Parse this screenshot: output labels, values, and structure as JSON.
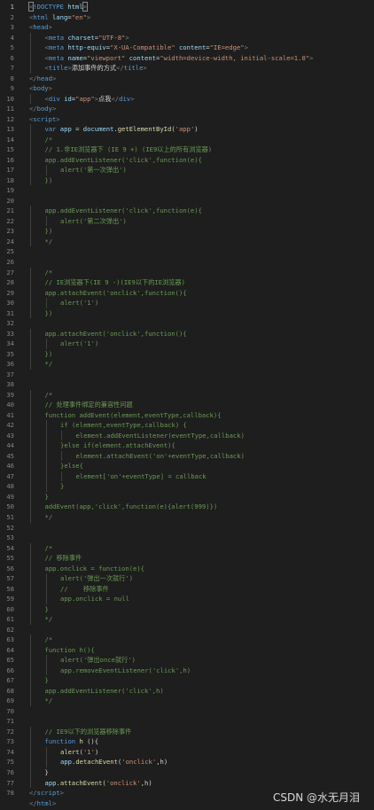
{
  "editor": {
    "lines": [
      {
        "n": "1",
        "indent": 0,
        "segs": [
          {
            "t": "<",
            "c": "c-pun"
          },
          {
            "t": "!DOCTYPE",
            "c": "c-tag"
          },
          {
            "t": " html",
            "c": "c-attr"
          },
          {
            "t": ">",
            "c": "c-pun"
          }
        ]
      },
      {
        "n": "2",
        "indent": 0,
        "segs": [
          {
            "t": "<",
            "c": "c-pun"
          },
          {
            "t": "html",
            "c": "c-tag"
          },
          {
            "t": " lang",
            "c": "c-attr"
          },
          {
            "t": "=",
            "c": "c-txt"
          },
          {
            "t": "\"en\"",
            "c": "c-str"
          },
          {
            "t": ">",
            "c": "c-pun"
          }
        ]
      },
      {
        "n": "3",
        "indent": 0,
        "segs": [
          {
            "t": "<",
            "c": "c-pun"
          },
          {
            "t": "head",
            "c": "c-tag"
          },
          {
            "t": ">",
            "c": "c-pun"
          }
        ]
      },
      {
        "n": "4",
        "indent": 1,
        "segs": [
          {
            "t": "<",
            "c": "c-pun"
          },
          {
            "t": "meta",
            "c": "c-tag"
          },
          {
            "t": " charset",
            "c": "c-attr"
          },
          {
            "t": "=",
            "c": "c-txt"
          },
          {
            "t": "\"UTF-8\"",
            "c": "c-str"
          },
          {
            "t": ">",
            "c": "c-pun"
          }
        ]
      },
      {
        "n": "5",
        "indent": 1,
        "segs": [
          {
            "t": "<",
            "c": "c-pun"
          },
          {
            "t": "meta",
            "c": "c-tag"
          },
          {
            "t": " http-equiv",
            "c": "c-attr"
          },
          {
            "t": "=",
            "c": "c-txt"
          },
          {
            "t": "\"X-UA-Compatible\"",
            "c": "c-str"
          },
          {
            "t": " content",
            "c": "c-attr"
          },
          {
            "t": "=",
            "c": "c-txt"
          },
          {
            "t": "\"IE=edge\"",
            "c": "c-str"
          },
          {
            "t": ">",
            "c": "c-pun"
          }
        ]
      },
      {
        "n": "6",
        "indent": 1,
        "segs": [
          {
            "t": "<",
            "c": "c-pun"
          },
          {
            "t": "meta",
            "c": "c-tag"
          },
          {
            "t": " name",
            "c": "c-attr"
          },
          {
            "t": "=",
            "c": "c-txt"
          },
          {
            "t": "\"viewport\"",
            "c": "c-str"
          },
          {
            "t": " content",
            "c": "c-attr"
          },
          {
            "t": "=",
            "c": "c-txt"
          },
          {
            "t": "\"width=device-width, initial-scale=1.0\"",
            "c": "c-str"
          },
          {
            "t": ">",
            "c": "c-pun"
          }
        ]
      },
      {
        "n": "7",
        "indent": 1,
        "segs": [
          {
            "t": "<",
            "c": "c-pun"
          },
          {
            "t": "title",
            "c": "c-tag"
          },
          {
            "t": ">",
            "c": "c-pun"
          },
          {
            "t": "添加事件的方式",
            "c": "c-txt"
          },
          {
            "t": "</",
            "c": "c-pun"
          },
          {
            "t": "title",
            "c": "c-tag"
          },
          {
            "t": ">",
            "c": "c-pun"
          }
        ]
      },
      {
        "n": "8",
        "indent": 0,
        "segs": [
          {
            "t": "</",
            "c": "c-pun"
          },
          {
            "t": "head",
            "c": "c-tag"
          },
          {
            "t": ">",
            "c": "c-pun"
          }
        ]
      },
      {
        "n": "9",
        "indent": 0,
        "segs": [
          {
            "t": "<",
            "c": "c-pun"
          },
          {
            "t": "body",
            "c": "c-tag"
          },
          {
            "t": ">",
            "c": "c-pun"
          }
        ]
      },
      {
        "n": "10",
        "indent": 1,
        "segs": [
          {
            "t": "<",
            "c": "c-pun"
          },
          {
            "t": "div",
            "c": "c-tag"
          },
          {
            "t": " id",
            "c": "c-attr"
          },
          {
            "t": "=",
            "c": "c-txt"
          },
          {
            "t": "\"app\"",
            "c": "c-str"
          },
          {
            "t": ">",
            "c": "c-pun"
          },
          {
            "t": "点我",
            "c": "c-txt"
          },
          {
            "t": "</",
            "c": "c-pun"
          },
          {
            "t": "div",
            "c": "c-tag"
          },
          {
            "t": ">",
            "c": "c-pun"
          }
        ]
      },
      {
        "n": "11",
        "indent": 0,
        "segs": [
          {
            "t": "</",
            "c": "c-pun"
          },
          {
            "t": "body",
            "c": "c-tag"
          },
          {
            "t": ">",
            "c": "c-pun"
          }
        ]
      },
      {
        "n": "12",
        "indent": 0,
        "segs": [
          {
            "t": "<",
            "c": "c-pun"
          },
          {
            "t": "script",
            "c": "c-tag"
          },
          {
            "t": ">",
            "c": "c-pun"
          }
        ]
      },
      {
        "n": "13",
        "indent": 1,
        "segs": [
          {
            "t": "var",
            "c": "c-kw"
          },
          {
            "t": " app",
            "c": "c-var"
          },
          {
            "t": " = ",
            "c": "c-txt"
          },
          {
            "t": "document",
            "c": "c-var"
          },
          {
            "t": ".",
            "c": "c-txt"
          },
          {
            "t": "getElementById",
            "c": "c-fn"
          },
          {
            "t": "(",
            "c": "c-txt"
          },
          {
            "t": "'app'",
            "c": "c-str"
          },
          {
            "t": ")",
            "c": "c-txt"
          }
        ]
      },
      {
        "n": "14",
        "indent": 1,
        "segs": [
          {
            "t": "/*",
            "c": "c-com"
          }
        ]
      },
      {
        "n": "15",
        "indent": 1,
        "segs": [
          {
            "t": "// 1.非IE浏览器下 (IE 9 +) (IE9以上的所有浏览器)",
            "c": "c-com"
          }
        ]
      },
      {
        "n": "16",
        "indent": 1,
        "segs": [
          {
            "t": "app.addEventListener('click',function(e){",
            "c": "c-com"
          }
        ]
      },
      {
        "n": "17",
        "indent": 2,
        "segs": [
          {
            "t": "alert('第一次弹出')",
            "c": "c-com"
          }
        ]
      },
      {
        "n": "18",
        "indent": 1,
        "segs": [
          {
            "t": "})",
            "c": "c-com"
          }
        ]
      },
      {
        "n": "19",
        "indent": 0,
        "segs": []
      },
      {
        "n": "20",
        "indent": 0,
        "segs": []
      },
      {
        "n": "21",
        "indent": 1,
        "segs": [
          {
            "t": "app.addEventListener('click',function(e){",
            "c": "c-com"
          }
        ]
      },
      {
        "n": "22",
        "indent": 2,
        "segs": [
          {
            "t": "alert('第二次弹出')",
            "c": "c-com"
          }
        ]
      },
      {
        "n": "23",
        "indent": 1,
        "segs": [
          {
            "t": "})",
            "c": "c-com"
          }
        ]
      },
      {
        "n": "24",
        "indent": 1,
        "segs": [
          {
            "t": "*/",
            "c": "c-com"
          }
        ]
      },
      {
        "n": "25",
        "indent": 0,
        "segs": []
      },
      {
        "n": "26",
        "indent": 0,
        "segs": []
      },
      {
        "n": "27",
        "indent": 1,
        "segs": [
          {
            "t": "/*",
            "c": "c-com"
          }
        ]
      },
      {
        "n": "28",
        "indent": 1,
        "segs": [
          {
            "t": "// IE浏览器下(IE 9 -)(IE9以下的IE浏览器)",
            "c": "c-com"
          }
        ]
      },
      {
        "n": "29",
        "indent": 1,
        "segs": [
          {
            "t": "app.attachEvent('onclick',function(){",
            "c": "c-com"
          }
        ]
      },
      {
        "n": "30",
        "indent": 2,
        "segs": [
          {
            "t": "alert('1')",
            "c": "c-com"
          }
        ]
      },
      {
        "n": "31",
        "indent": 1,
        "segs": [
          {
            "t": "})",
            "c": "c-com"
          }
        ]
      },
      {
        "n": "32",
        "indent": 0,
        "segs": []
      },
      {
        "n": "33",
        "indent": 1,
        "segs": [
          {
            "t": "app.attachEvent('onclick',function(){",
            "c": "c-com"
          }
        ]
      },
      {
        "n": "34",
        "indent": 2,
        "segs": [
          {
            "t": "alert('1')",
            "c": "c-com"
          }
        ]
      },
      {
        "n": "35",
        "indent": 1,
        "segs": [
          {
            "t": "})",
            "c": "c-com"
          }
        ]
      },
      {
        "n": "36",
        "indent": 1,
        "segs": [
          {
            "t": "*/",
            "c": "c-com"
          }
        ]
      },
      {
        "n": "37",
        "indent": 0,
        "segs": []
      },
      {
        "n": "38",
        "indent": 0,
        "segs": []
      },
      {
        "n": "39",
        "indent": 1,
        "segs": [
          {
            "t": "/*",
            "c": "c-com"
          }
        ]
      },
      {
        "n": "40",
        "indent": 1,
        "segs": [
          {
            "t": "// 处理事件绑定的兼容性问题",
            "c": "c-com"
          }
        ]
      },
      {
        "n": "41",
        "indent": 1,
        "segs": [
          {
            "t": "function addEvent(element,eventType,callback){",
            "c": "c-com"
          }
        ]
      },
      {
        "n": "42",
        "indent": 2,
        "segs": [
          {
            "t": "if (element,eventType,callback) {",
            "c": "c-com"
          }
        ]
      },
      {
        "n": "43",
        "indent": 3,
        "segs": [
          {
            "t": "element.addEventListener(eventType,callback)",
            "c": "c-com"
          }
        ]
      },
      {
        "n": "44",
        "indent": 2,
        "segs": [
          {
            "t": "}else if(element.attachEvent){",
            "c": "c-com"
          }
        ]
      },
      {
        "n": "45",
        "indent": 3,
        "segs": [
          {
            "t": "element.attachEvent('on'+eventType,callback)",
            "c": "c-com"
          }
        ]
      },
      {
        "n": "46",
        "indent": 2,
        "segs": [
          {
            "t": "}else{",
            "c": "c-com"
          }
        ]
      },
      {
        "n": "47",
        "indent": 3,
        "segs": [
          {
            "t": "element['on'+eventType] = callback",
            "c": "c-com"
          }
        ]
      },
      {
        "n": "48",
        "indent": 2,
        "segs": [
          {
            "t": "}",
            "c": "c-com"
          }
        ]
      },
      {
        "n": "49",
        "indent": 1,
        "segs": [
          {
            "t": "}",
            "c": "c-com"
          }
        ]
      },
      {
        "n": "50",
        "indent": 1,
        "segs": [
          {
            "t": "addEvent(app,'click',function(e){alert(999)})",
            "c": "c-com"
          }
        ]
      },
      {
        "n": "51",
        "indent": 1,
        "segs": [
          {
            "t": "*/",
            "c": "c-com"
          }
        ]
      },
      {
        "n": "52",
        "indent": 0,
        "segs": []
      },
      {
        "n": "53",
        "indent": 0,
        "segs": []
      },
      {
        "n": "54",
        "indent": 1,
        "segs": [
          {
            "t": "/*",
            "c": "c-com"
          }
        ]
      },
      {
        "n": "55",
        "indent": 1,
        "segs": [
          {
            "t": "// 移除事件",
            "c": "c-com"
          }
        ]
      },
      {
        "n": "56",
        "indent": 1,
        "segs": [
          {
            "t": "app.onclick = function(e){",
            "c": "c-com"
          }
        ]
      },
      {
        "n": "57",
        "indent": 2,
        "segs": [
          {
            "t": "alert('弹出一次就行')",
            "c": "c-com"
          }
        ]
      },
      {
        "n": "58",
        "indent": 2,
        "segs": [
          {
            "t": "//    移除事件",
            "c": "c-com"
          }
        ]
      },
      {
        "n": "59",
        "indent": 2,
        "segs": [
          {
            "t": "app.onclick = null",
            "c": "c-com"
          }
        ]
      },
      {
        "n": "60",
        "indent": 1,
        "segs": [
          {
            "t": "}",
            "c": "c-com"
          }
        ]
      },
      {
        "n": "61",
        "indent": 1,
        "segs": [
          {
            "t": "*/",
            "c": "c-com"
          }
        ]
      },
      {
        "n": "62",
        "indent": 0,
        "segs": []
      },
      {
        "n": "63",
        "indent": 1,
        "segs": [
          {
            "t": "/*",
            "c": "c-com"
          }
        ]
      },
      {
        "n": "64",
        "indent": 1,
        "segs": [
          {
            "t": "function h(){",
            "c": "c-com"
          }
        ]
      },
      {
        "n": "65",
        "indent": 2,
        "segs": [
          {
            "t": "alert('弹出once就行')",
            "c": "c-com"
          }
        ]
      },
      {
        "n": "66",
        "indent": 2,
        "segs": [
          {
            "t": "app.removeEventListener('click',h)",
            "c": "c-com"
          }
        ]
      },
      {
        "n": "67",
        "indent": 1,
        "segs": [
          {
            "t": "}",
            "c": "c-com"
          }
        ]
      },
      {
        "n": "68",
        "indent": 1,
        "segs": [
          {
            "t": "app.addEventListener('click',h)",
            "c": "c-com"
          }
        ]
      },
      {
        "n": "69",
        "indent": 1,
        "segs": [
          {
            "t": "*/",
            "c": "c-com"
          }
        ]
      },
      {
        "n": "70",
        "indent": 0,
        "segs": []
      },
      {
        "n": "71",
        "indent": 0,
        "segs": []
      },
      {
        "n": "72",
        "indent": 1,
        "segs": [
          {
            "t": "// IE9以下的浏览器移除事件",
            "c": "c-com"
          }
        ]
      },
      {
        "n": "73",
        "indent": 1,
        "segs": [
          {
            "t": "function",
            "c": "c-kw"
          },
          {
            "t": " h",
            "c": "c-fn"
          },
          {
            "t": " (){",
            "c": "c-txt"
          }
        ]
      },
      {
        "n": "74",
        "indent": 2,
        "segs": [
          {
            "t": "alert",
            "c": "c-fn"
          },
          {
            "t": "(",
            "c": "c-txt"
          },
          {
            "t": "'1'",
            "c": "c-str"
          },
          {
            "t": ")",
            "c": "c-txt"
          }
        ]
      },
      {
        "n": "75",
        "indent": 2,
        "segs": [
          {
            "t": "app",
            "c": "c-var"
          },
          {
            "t": ".",
            "c": "c-txt"
          },
          {
            "t": "detachEvent",
            "c": "c-fn"
          },
          {
            "t": "(",
            "c": "c-txt"
          },
          {
            "t": "'onclick'",
            "c": "c-str"
          },
          {
            "t": ",h)",
            "c": "c-txt"
          }
        ]
      },
      {
        "n": "76",
        "indent": 1,
        "segs": [
          {
            "t": "}",
            "c": "c-txt"
          }
        ]
      },
      {
        "n": "77",
        "indent": 1,
        "segs": [
          {
            "t": "app",
            "c": "c-var"
          },
          {
            "t": ".",
            "c": "c-txt"
          },
          {
            "t": "attachEvent",
            "c": "c-fn"
          },
          {
            "t": "(",
            "c": "c-txt"
          },
          {
            "t": "'onclick'",
            "c": "c-str"
          },
          {
            "t": ",h)",
            "c": "c-txt"
          }
        ]
      },
      {
        "n": "78",
        "indent": 0,
        "segs": [
          {
            "t": "</",
            "c": "c-pun"
          },
          {
            "t": "script",
            "c": "c-tag"
          },
          {
            "t": ">",
            "c": "c-pun"
          }
        ]
      },
      {
        "n": "",
        "indent": 0,
        "segs": [
          {
            "t": "</",
            "c": "c-pun"
          },
          {
            "t": "html",
            "c": "c-tag"
          },
          {
            "t": ">",
            "c": "c-pun"
          }
        ]
      }
    ]
  },
  "watermark": {
    "text": "CSDN @水无月泪"
  },
  "colors": {
    "background": "#1e1e1e",
    "line_number": "#858585",
    "tag": "#569cd6",
    "attribute": "#9cdcfe",
    "string": "#ce9178",
    "comment": "#6a9955",
    "function": "#dcdcaa"
  }
}
